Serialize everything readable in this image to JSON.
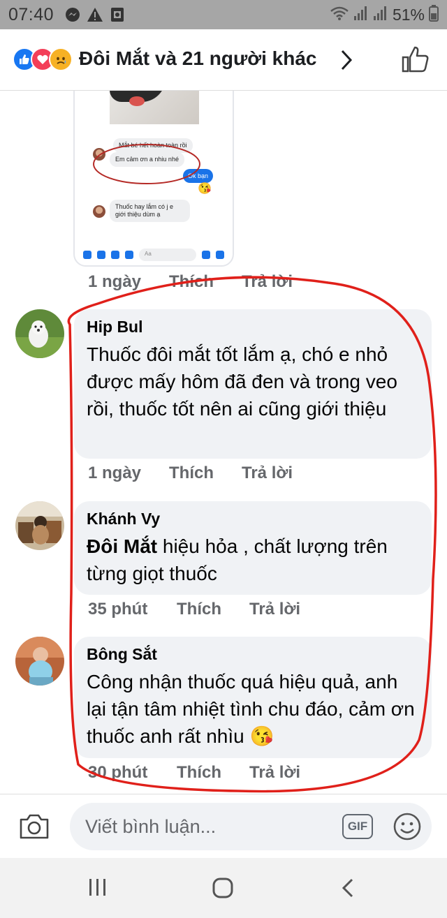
{
  "status_bar": {
    "time": "07:40",
    "battery": "51%",
    "icons": [
      "messenger-icon",
      "warning-icon",
      "photo-icon",
      "wifi-icon",
      "signal-icon",
      "signal-icon-2",
      "battery-icon"
    ]
  },
  "header": {
    "reactions": [
      "like",
      "love",
      "sad"
    ],
    "title": "Đôi Mắt và 21 người khác"
  },
  "screenshot_card": {
    "bubble1": "Mắt bé hết hoàn toàn rồi",
    "bubble2": "Em cảm ơn a nhiu nhé",
    "reply": "Ok bạn",
    "bubble3": "Thuốc hay lắm có j e giới thiệu dùm ạ",
    "input_placeholder": "Aa"
  },
  "first_meta": {
    "time": "1 ngày",
    "like": "Thích",
    "reply": "Trả lời"
  },
  "comments": [
    {
      "author": "Hip Bul",
      "text": "Thuốc đôi mắt tốt lắm  ạ, chó e nhỏ được mấy hôm đã đen và trong veo rồi, thuốc tốt nên ai cũng giới thiệu",
      "time": "1 ngày",
      "like": "Thích",
      "reply": "Trả lời"
    },
    {
      "author": "Khánh Vy",
      "mention": "Đôi Mắt",
      "text": "hiệu hỏa , chất lượng trên từng giọt thuốc",
      "time": "35 phút",
      "like": "Thích",
      "reply": "Trả lời"
    },
    {
      "author": "Bông Sắt",
      "text": "Công nhận thuốc quá hiệu quả, anh lại tận tâm nhiệt tình chu đáo, cảm ơn thuốc anh rất nhìu 😘",
      "time": "30 phút",
      "like": "Thích",
      "reply": "Trả lời"
    }
  ],
  "composer": {
    "placeholder": "Viết bình luận...",
    "gif_label": "GIF"
  },
  "colors": {
    "accent": "#1877f2",
    "annotation_red": "#e0201a"
  }
}
